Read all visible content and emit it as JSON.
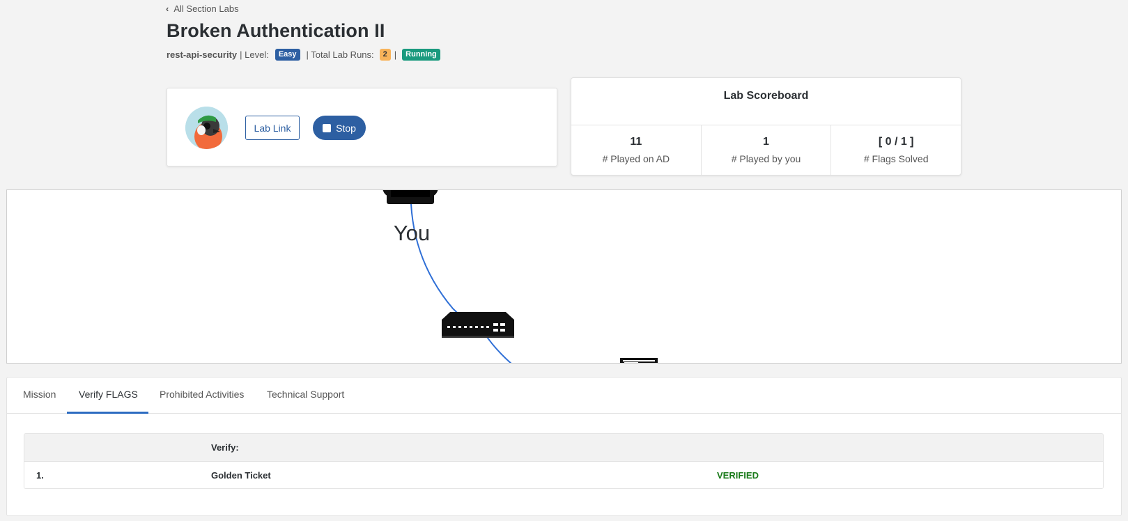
{
  "header": {
    "back_label": "All Section Labs",
    "title": "Broken Authentication II",
    "meta": {
      "lab_slug": "rest-api-security",
      "level_label": "| Level:",
      "level": "Easy",
      "runs_label": "| Total Lab Runs:",
      "runs_count": "2",
      "status": "Running"
    }
  },
  "user_card": {
    "lab_link_label": "Lab Link",
    "stop_label": "Stop"
  },
  "scoreboard": {
    "title": "Lab Scoreboard",
    "cells": [
      {
        "value": "11",
        "label": "# Played on AD"
      },
      {
        "value": "1",
        "label": "# Played by you"
      },
      {
        "value": "[ 0 / 1 ]",
        "label": "# Flags Solved"
      }
    ]
  },
  "network": {
    "you_label": "You",
    "link_color": "#2f6fd6"
  },
  "tabs": {
    "items": [
      "Mission",
      "Verify FLAGS",
      "Prohibited Activities",
      "Technical Support"
    ],
    "active": "Verify FLAGS"
  },
  "verify_table": {
    "header": "Verify:",
    "rows": [
      {
        "index": "1.",
        "name": "Golden Ticket",
        "status": "VERIFIED"
      }
    ]
  },
  "colors": {
    "primary": "#2d5fa2",
    "running": "#1a9a7e",
    "count_badge": "#f8b35a",
    "verified": "#1a7a1a"
  }
}
